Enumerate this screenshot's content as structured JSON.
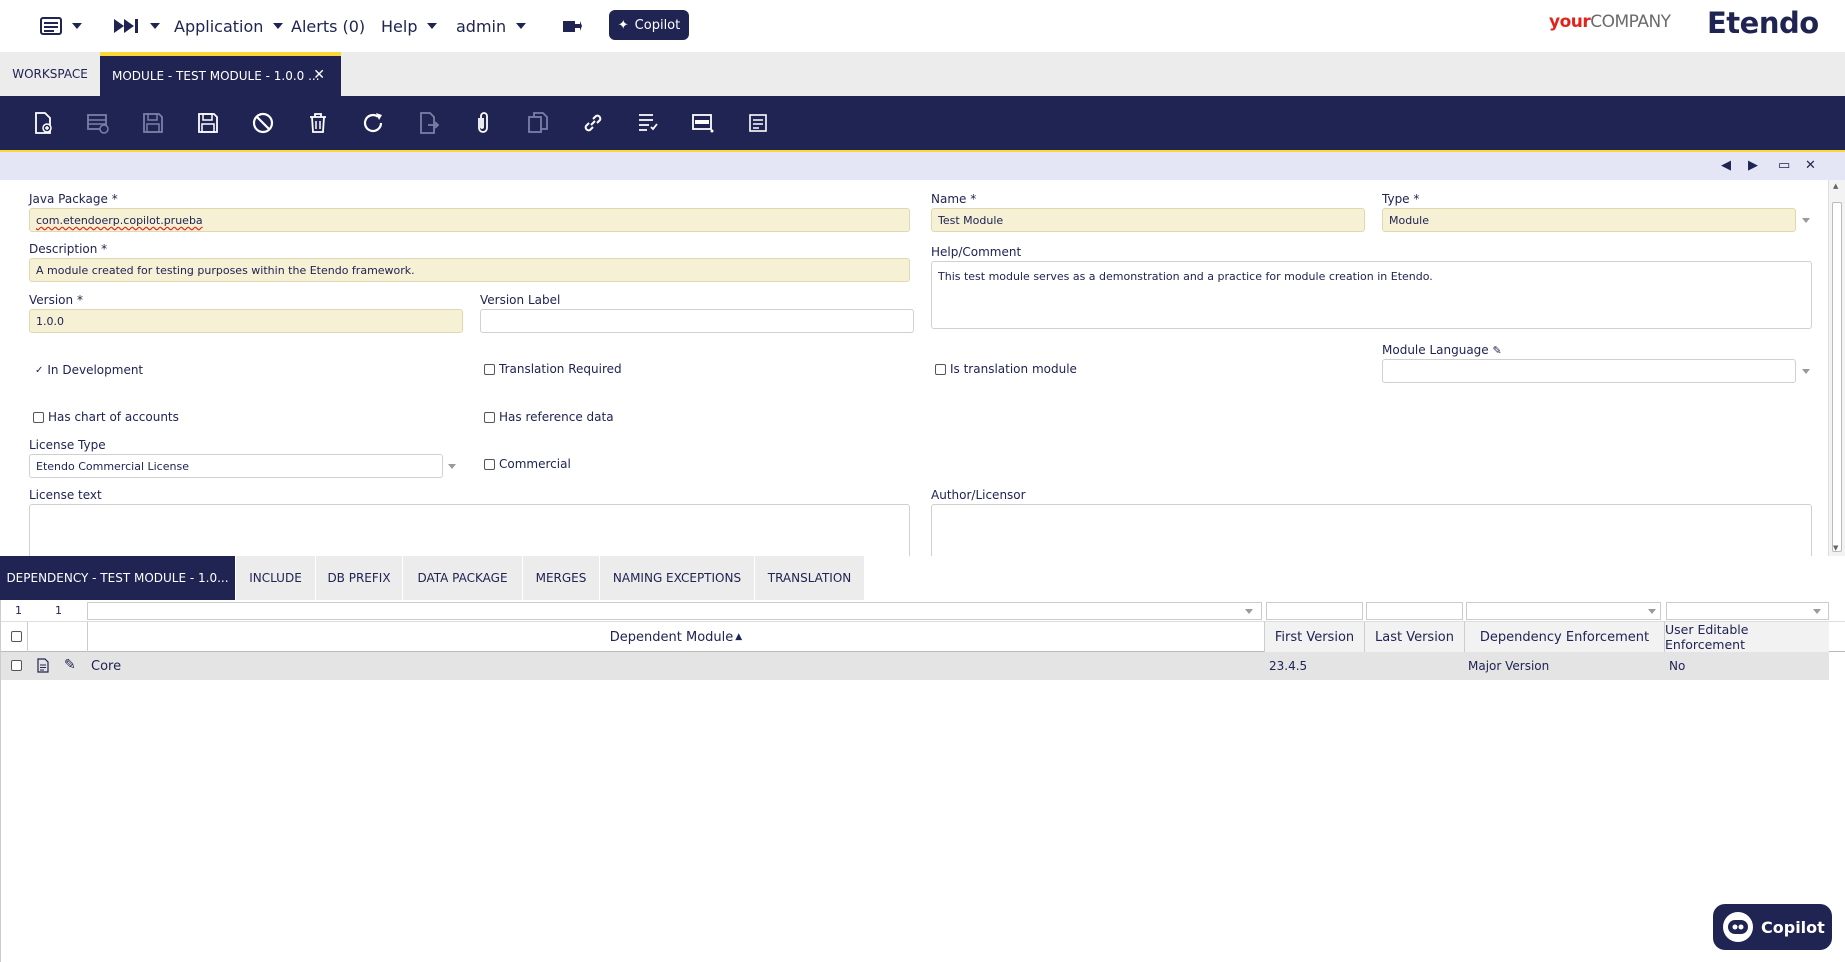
{
  "topbar": {
    "application": "Application",
    "alerts": "Alerts (0)",
    "help": "Help",
    "user": "admin",
    "copilot": "Copilot",
    "logo_your": "your",
    "logo_company": "COMPANY",
    "logo_etendo": "Etendo"
  },
  "tabs": {
    "workspace": "WORKSPACE",
    "module": "MODULE - TEST MODULE - 1.0.0 ..."
  },
  "form": {
    "java_package_label": "Java Package *",
    "java_package_value": "com.etendoerp.copilot.prueba",
    "name_label": "Name *",
    "name_value": "Test Module",
    "type_label": "Type *",
    "type_value": "Module",
    "description_label": "Description *",
    "description_value": "A module created for testing purposes within the Etendo framework.",
    "help_label": "Help/Comment",
    "help_value": "This test module serves as a demonstration and a practice for module creation in Etendo.",
    "version_label": "Version *",
    "version_value": "1.0.0",
    "version_label_label": "Version Label",
    "version_label_value": "",
    "in_development": "In Development",
    "translation_required": "Translation Required",
    "is_translation_module": "Is translation module",
    "module_language_label": "Module Language",
    "module_language_value": "",
    "has_chart_of_accounts": "Has chart of accounts",
    "has_reference_data": "Has reference data",
    "license_type_label": "License Type",
    "license_type_value": "Etendo Commercial License",
    "commercial": "Commercial",
    "license_text_label": "License text",
    "author_label": "Author/Licensor"
  },
  "subtabs": [
    "DEPENDENCY - TEST MODULE - 1.0...",
    "INCLUDE",
    "DB PREFIX",
    "DATA PACKAGE",
    "MERGES",
    "NAMING EXCEPTIONS",
    "TRANSLATION"
  ],
  "grid": {
    "count_left": "1",
    "count_right": "1",
    "columns": [
      "Dependent Module",
      "First Version",
      "Last Version",
      "Dependency Enforcement",
      "User Editable Enforcement"
    ],
    "sort_indicator": "▲",
    "rows": [
      {
        "module": "Core",
        "first_version": "23.4.5",
        "last_version": "",
        "enforcement": "Major Version",
        "user_editable": "No"
      }
    ]
  },
  "copilot_float": "Copilot"
}
